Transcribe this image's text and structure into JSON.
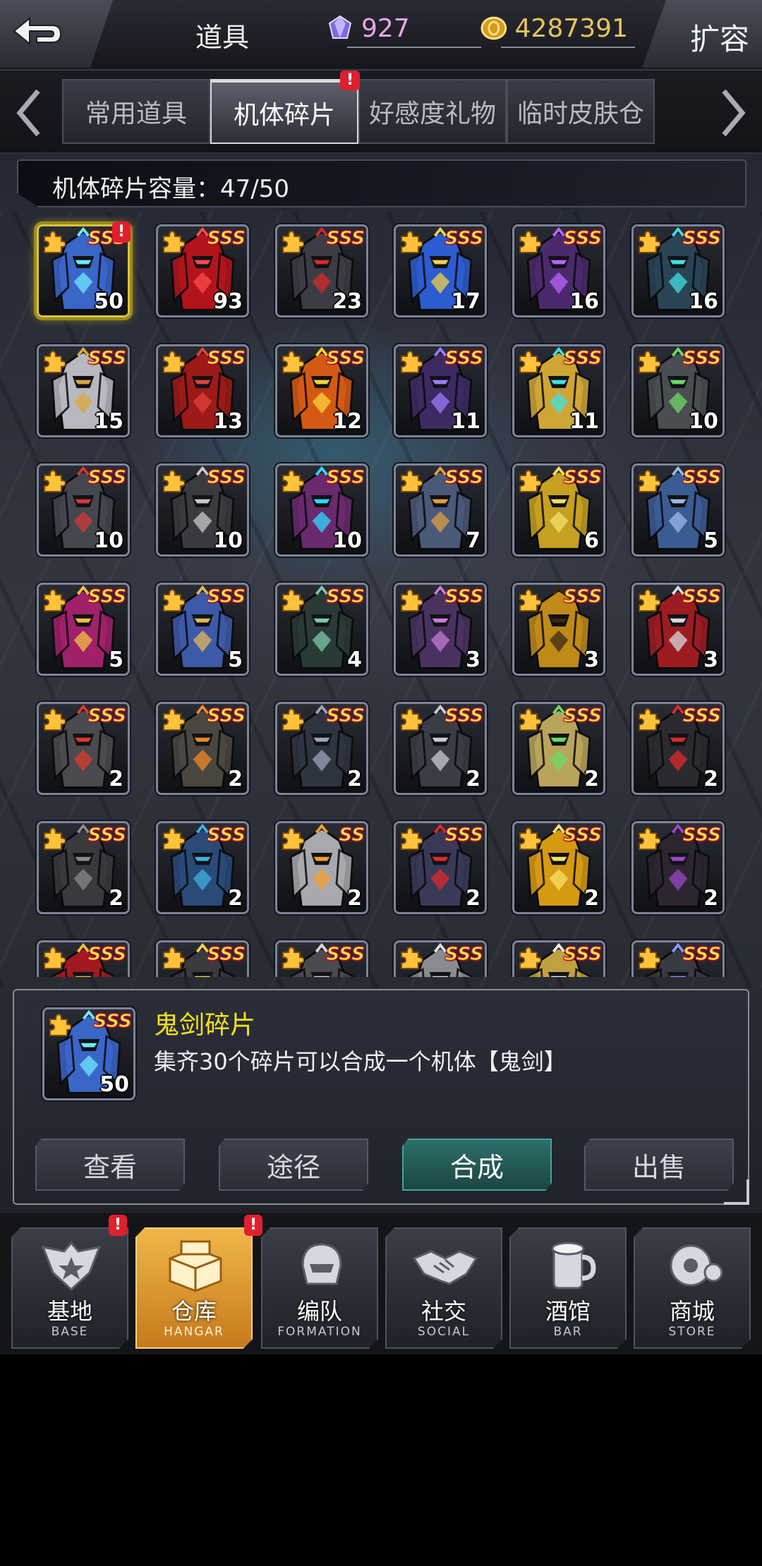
{
  "header": {
    "title": "道具",
    "gems": "927",
    "gold": "4287391",
    "expand_label": "扩容"
  },
  "tabs": [
    {
      "label": "常用道具",
      "active": false
    },
    {
      "label": "机体碎片",
      "active": true,
      "badge": "!"
    },
    {
      "label": "好感度礼物",
      "active": false
    },
    {
      "label": "临时皮肤仓",
      "active": false
    }
  ],
  "capacity_text": "机体碎片容量：47/50",
  "items": [
    {
      "count": "50",
      "rank": "SSS",
      "color": "#3a66c8",
      "accent": "#6fe9ff",
      "selected": true,
      "badge": "!"
    },
    {
      "count": "93",
      "rank": "SSS",
      "color": "#b3141c",
      "accent": "#ff4a4a"
    },
    {
      "count": "23",
      "rank": "SSS",
      "color": "#3c3d44",
      "accent": "#d42a2a"
    },
    {
      "count": "17",
      "rank": "SSS",
      "color": "#2c5ccf",
      "accent": "#f0d24a"
    },
    {
      "count": "16",
      "rank": "SSS",
      "color": "#4a2a6c",
      "accent": "#b865ff"
    },
    {
      "count": "16",
      "rank": "SSS",
      "color": "#2a4456",
      "accent": "#3fe0e0"
    },
    {
      "count": "15",
      "rank": "SSS",
      "color": "#b8b8c0",
      "accent": "#d8a842"
    },
    {
      "count": "13",
      "rank": "SSS",
      "color": "#9c1a18",
      "accent": "#e0423a"
    },
    {
      "count": "12",
      "rank": "SSS",
      "color": "#d45a14",
      "accent": "#ffd23a"
    },
    {
      "count": "11",
      "rank": "SSS",
      "color": "#3d2a62",
      "accent": "#9d7bff"
    },
    {
      "count": "11",
      "rank": "SSS",
      "color": "#cfa636",
      "accent": "#3fe0e0"
    },
    {
      "count": "10",
      "rank": "SSS",
      "color": "#4a4d52",
      "accent": "#6fd86a"
    },
    {
      "count": "10",
      "rank": "SSS",
      "color": "#44484e",
      "accent": "#d43a3a"
    },
    {
      "count": "10",
      "rank": "SSS",
      "color": "#3a3b40",
      "accent": "#c9c9c9"
    },
    {
      "count": "10",
      "rank": "SSS",
      "color": "#6a2a6e",
      "accent": "#2fd8ff"
    },
    {
      "count": "7",
      "rank": "SSS",
      "color": "#4a5a78",
      "accent": "#e0a040"
    },
    {
      "count": "6",
      "rank": "SSS",
      "color": "#c6a020",
      "accent": "#f5e06a"
    },
    {
      "count": "5",
      "rank": "SSS",
      "color": "#3b5c92",
      "accent": "#9cb8e8"
    },
    {
      "count": "5",
      "rank": "SSS",
      "color": "#a0206a",
      "accent": "#f5c040"
    },
    {
      "count": "5",
      "rank": "SSS",
      "color": "#3d5aa8",
      "accent": "#e0b85a"
    },
    {
      "count": "4",
      "rank": "SSS",
      "color": "#2a3a36",
      "accent": "#7fc8a8"
    },
    {
      "count": "3",
      "rank": "SSS",
      "color": "#4a3260",
      "accent": "#c77bd8"
    },
    {
      "count": "3",
      "rank": "SSS",
      "color": "#c08a18",
      "accent": "#3a2a14"
    },
    {
      "count": "3",
      "rank": "SSS",
      "color": "#9c1c22",
      "accent": "#d8d8dc"
    },
    {
      "count": "2",
      "rank": "SSS",
      "color": "#4a4a50",
      "accent": "#e03a2a"
    },
    {
      "count": "2",
      "rank": "SSS",
      "color": "#4a4640",
      "accent": "#f08a2a"
    },
    {
      "count": "2",
      "rank": "SSS",
      "color": "#2e3440",
      "accent": "#9ca6b8"
    },
    {
      "count": "2",
      "rank": "SSS",
      "color": "#3a3d44",
      "accent": "#c9ccd6"
    },
    {
      "count": "2",
      "rank": "SSS",
      "color": "#b8a45a",
      "accent": "#6fd86a"
    },
    {
      "count": "2",
      "rank": "SSS",
      "color": "#2a2a30",
      "accent": "#e02a2a"
    },
    {
      "count": "2",
      "rank": "SSS",
      "color": "#3a3a3e",
      "accent": "#8a8a8e"
    },
    {
      "count": "2",
      "rank": "SSS",
      "color": "#2a4a78",
      "accent": "#40b0e0"
    },
    {
      "count": "2",
      "rank": "SS",
      "color": "#a8a8ae",
      "accent": "#f0a030"
    },
    {
      "count": "2",
      "rank": "SSS",
      "color": "#3a3a58",
      "accent": "#e02a2a"
    },
    {
      "count": "2",
      "rank": "SSS",
      "color": "#d69a12",
      "accent": "#f8e06a"
    },
    {
      "count": "2",
      "rank": "SSS",
      "color": "#2c2630",
      "accent": "#9a4ac8"
    },
    {
      "count": "",
      "rank": "SSS",
      "color": "#a01a20",
      "accent": "#e8c03a"
    },
    {
      "count": "",
      "rank": "SSS",
      "color": "#3a3a40",
      "accent": "#f0d24a"
    },
    {
      "count": "",
      "rank": "SSS",
      "color": "#4a4a50",
      "accent": "#d8d8dc"
    },
    {
      "count": "",
      "rank": "SSS",
      "color": "#8a8a90",
      "accent": "#e0e0e4"
    },
    {
      "count": "",
      "rank": "SSS",
      "color": "#c0a040",
      "accent": "#f0f0f0"
    },
    {
      "count": "",
      "rank": "SSS",
      "color": "#3a3a44",
      "accent": "#8a9aff"
    }
  ],
  "detail": {
    "name": "鬼剑碎片",
    "description": "集齐30个碎片可以合成一个机体【鬼剑】",
    "count": "50",
    "rank": "SSS",
    "color": "#3a66c8",
    "accent": "#6fe9ff",
    "actions": {
      "view": "查看",
      "route": "途径",
      "compose": "合成",
      "sell": "出售"
    }
  },
  "nav": [
    {
      "label": "基地",
      "sub": "BASE",
      "badge": "!",
      "icon": "base-emblem-icon"
    },
    {
      "label": "仓库",
      "sub": "HANGAR",
      "badge": "!",
      "active": true,
      "icon": "hangar-crate-icon"
    },
    {
      "label": "编队",
      "sub": "FORMATION",
      "icon": "formation-helmet-icon"
    },
    {
      "label": "社交",
      "sub": "SOCIAL",
      "icon": "handshake-icon"
    },
    {
      "label": "酒馆",
      "sub": "BAR",
      "icon": "bar-mug-icon"
    },
    {
      "label": "商城",
      "sub": "STORE",
      "icon": "store-orb-icon"
    }
  ],
  "colors": {
    "gold_text": "#e7c45c",
    "gem_text": "#e8a6e8",
    "item_name": "#f5e21a",
    "primary_button": "#2d6f69",
    "nav_active": "#f0b64a",
    "badge": "#e0202e"
  }
}
